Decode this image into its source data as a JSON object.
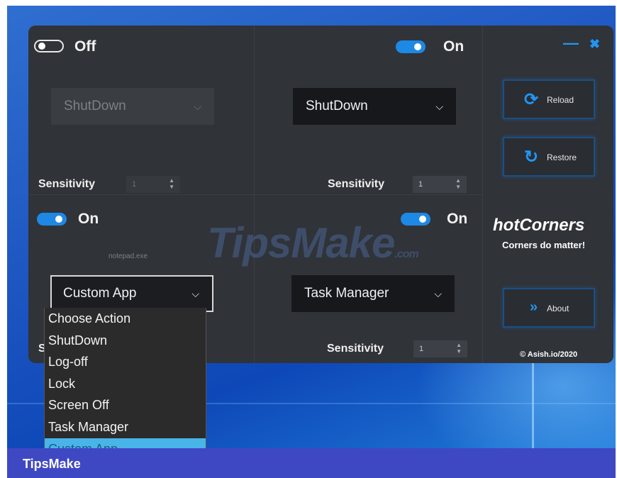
{
  "app": {
    "window_controls": {
      "minimize": "—",
      "close": "✖"
    },
    "corners": [
      {
        "id": "top-left",
        "toggle_state": "off",
        "toggle_label": "Off",
        "action": "ShutDown",
        "sensitivity_label": "Sensitivity",
        "sensitivity": "1",
        "disabled": true
      },
      {
        "id": "top-right",
        "toggle_state": "on",
        "toggle_label": "On",
        "action": "ShutDown",
        "sensitivity_label": "Sensitivity",
        "sensitivity": "1"
      },
      {
        "id": "bottom-left",
        "toggle_state": "on",
        "toggle_label": "On",
        "app_path": "notepad.exe",
        "action": "Custom App",
        "sensitivity_label": "Se"
      },
      {
        "id": "bottom-right",
        "toggle_state": "on",
        "toggle_label": "On",
        "action": "Task Manager",
        "sensitivity_label": "Sensitivity",
        "sensitivity": "1"
      }
    ],
    "dropdown_options": [
      "Choose Action",
      "ShutDown",
      "Log-off",
      "Lock",
      "Screen Off",
      "Task Manager",
      "Custom App"
    ],
    "dropdown_selected": "Custom App",
    "side_panel": {
      "reload_label": "Reload",
      "restore_label": "Restore",
      "brand": "hotCorners",
      "tagline": "Corners do matter!",
      "about_label": "About",
      "copyright": "© Asish.io/2020"
    }
  },
  "icons": {
    "reload": "reload-icon",
    "restore": "restore-icon",
    "about": "double-chevron-icon",
    "chevron": "chevron-down-icon"
  },
  "watermark": {
    "main": "TipsMake",
    "suffix": ".com"
  },
  "footer": {
    "label": "TipsMake"
  },
  "colors": {
    "accent": "#1e88e5",
    "window_bg": "#303338",
    "footer_bg": "#3f48c3",
    "highlight": "#49b4e8"
  }
}
